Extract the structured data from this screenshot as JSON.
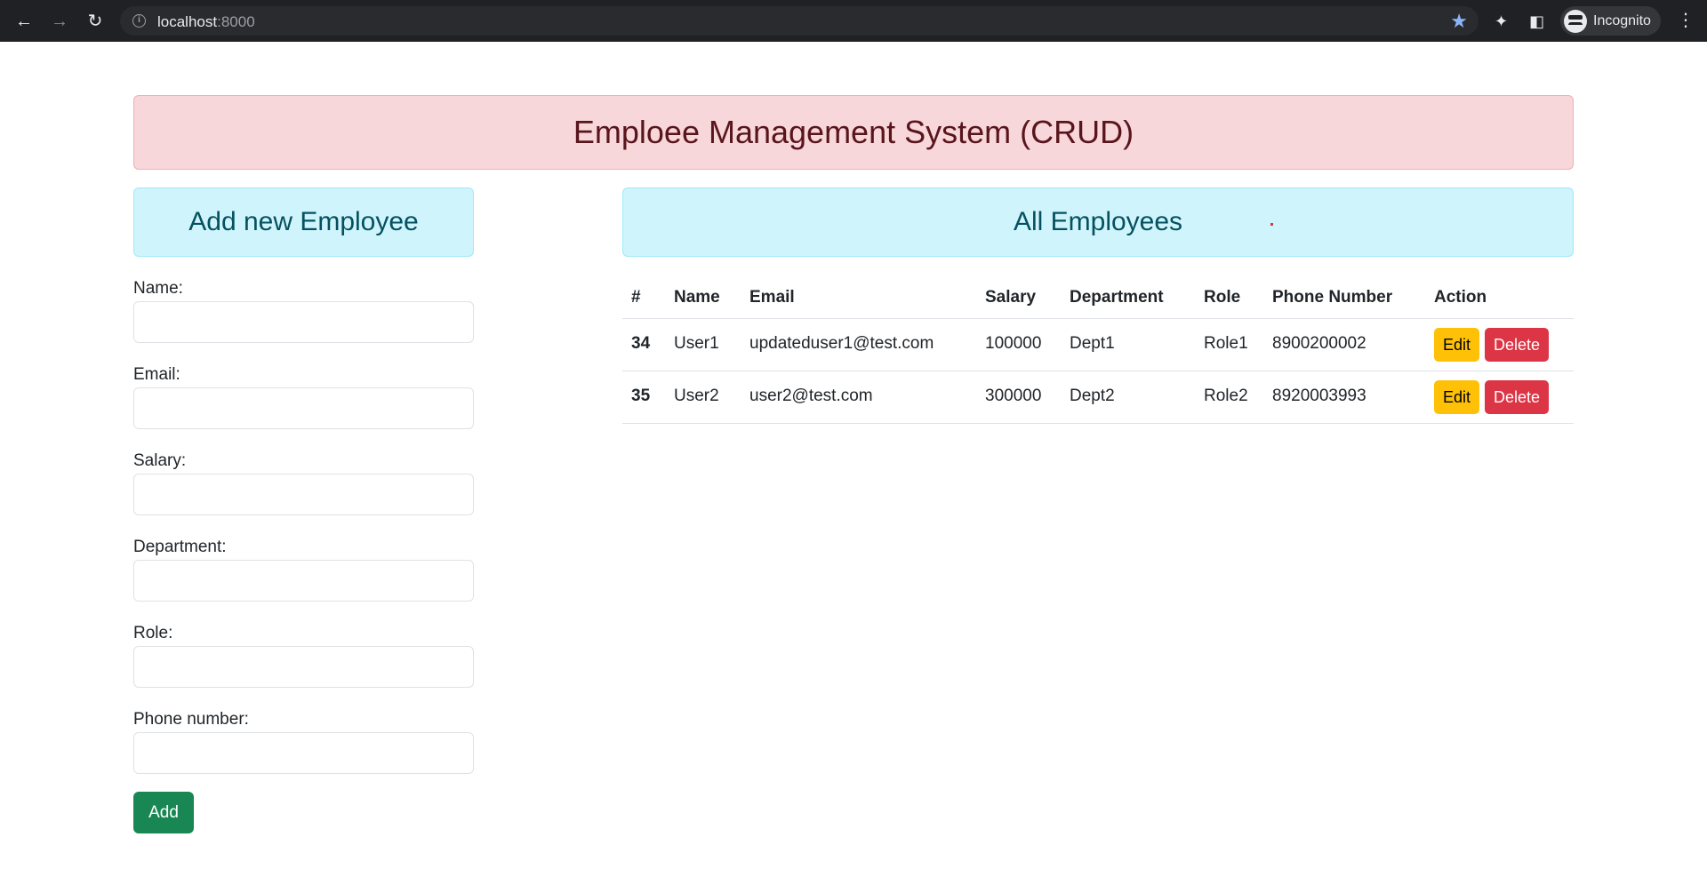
{
  "browser": {
    "url_host": "localhost",
    "url_port": ":8000",
    "profile_label": "Incognito"
  },
  "page": {
    "title": "Emploee Management System (CRUD)"
  },
  "form": {
    "heading": "Add new Employee",
    "labels": {
      "name": "Name:",
      "email": "Email:",
      "salary": "Salary:",
      "department": "Department:",
      "role": "Role:",
      "phone": "Phone number:"
    },
    "add_label": "Add"
  },
  "list": {
    "heading": "All Employees",
    "columns": [
      "#",
      "Name",
      "Email",
      "Salary",
      "Department",
      "Role",
      "Phone Number",
      "Action"
    ],
    "rows": [
      {
        "id": "34",
        "name": "User1",
        "email": "updateduser1@test.com",
        "salary": "100000",
        "department": "Dept1",
        "role": "Role1",
        "phone": "8900200002",
        "edit": "Edit",
        "delete": "Delete"
      },
      {
        "id": "35",
        "name": "User2",
        "email": "user2@test.com",
        "salary": "300000",
        "department": "Dept2",
        "role": "Role2",
        "phone": "8920003993",
        "edit": "Edit",
        "delete": "Delete"
      }
    ]
  },
  "colors": {
    "title_bg": "#f8d7da",
    "panel_bg": "#cff4fc",
    "add_button": "#198754",
    "edit_button": "#ffc107",
    "delete_button": "#dc3545"
  },
  "icons": [
    "back-arrow-icon",
    "forward-arrow-icon",
    "reload-icon",
    "info-icon",
    "star-icon",
    "extensions-icon",
    "side-panel-icon",
    "incognito-icon",
    "menu-icon"
  ]
}
